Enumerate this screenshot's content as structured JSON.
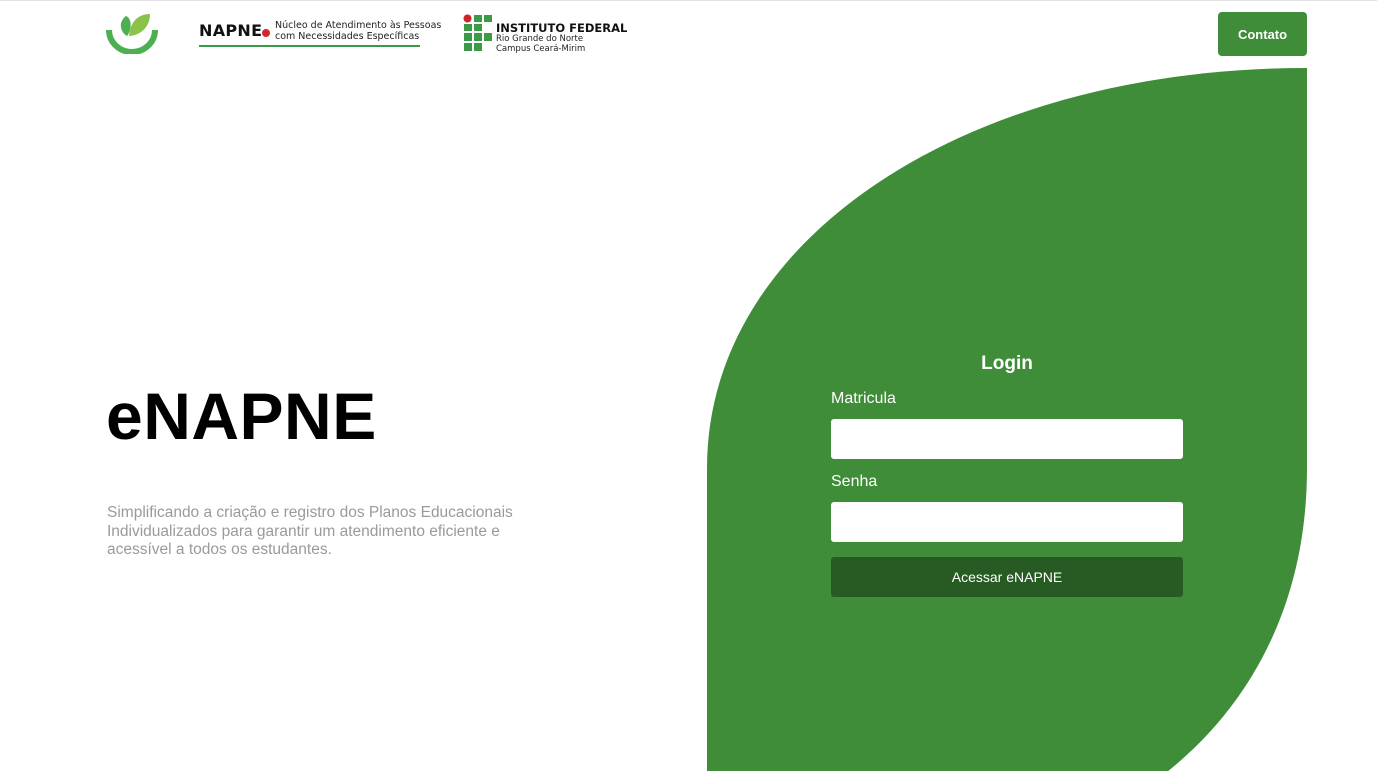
{
  "header": {
    "napne_logo": {
      "word": "NAPNE",
      "subtitle_line1": "Núcleo de Atendimento às Pessoas",
      "subtitle_line2": "com Necessidades Específicas"
    },
    "if_logo": {
      "title": "INSTITUTO FEDERAL",
      "line1": "Rio Grande do Norte",
      "line2": "Campus Ceará-Mirim"
    },
    "contact_label": "Contato"
  },
  "hero": {
    "title": "eNAPNE",
    "description": "Simplificando a criação e registro dos Planos Educacionais Individualizados para garantir um atendimento eficiente e acessível a todos os estudantes."
  },
  "login": {
    "title": "Login",
    "matricula_label": "Matricula",
    "matricula_value": "",
    "senha_label": "Senha",
    "senha_value": "",
    "submit_label": "Acessar eNAPNE"
  },
  "colors": {
    "brand_green": "#3f8d38",
    "dark_green": "#285b24",
    "if_red": "#c8242a",
    "logo_green": "#4caf50"
  },
  "icons": {
    "app_logo": "leaf-smile-icon",
    "if_grid": "if-square-grid-icon"
  }
}
